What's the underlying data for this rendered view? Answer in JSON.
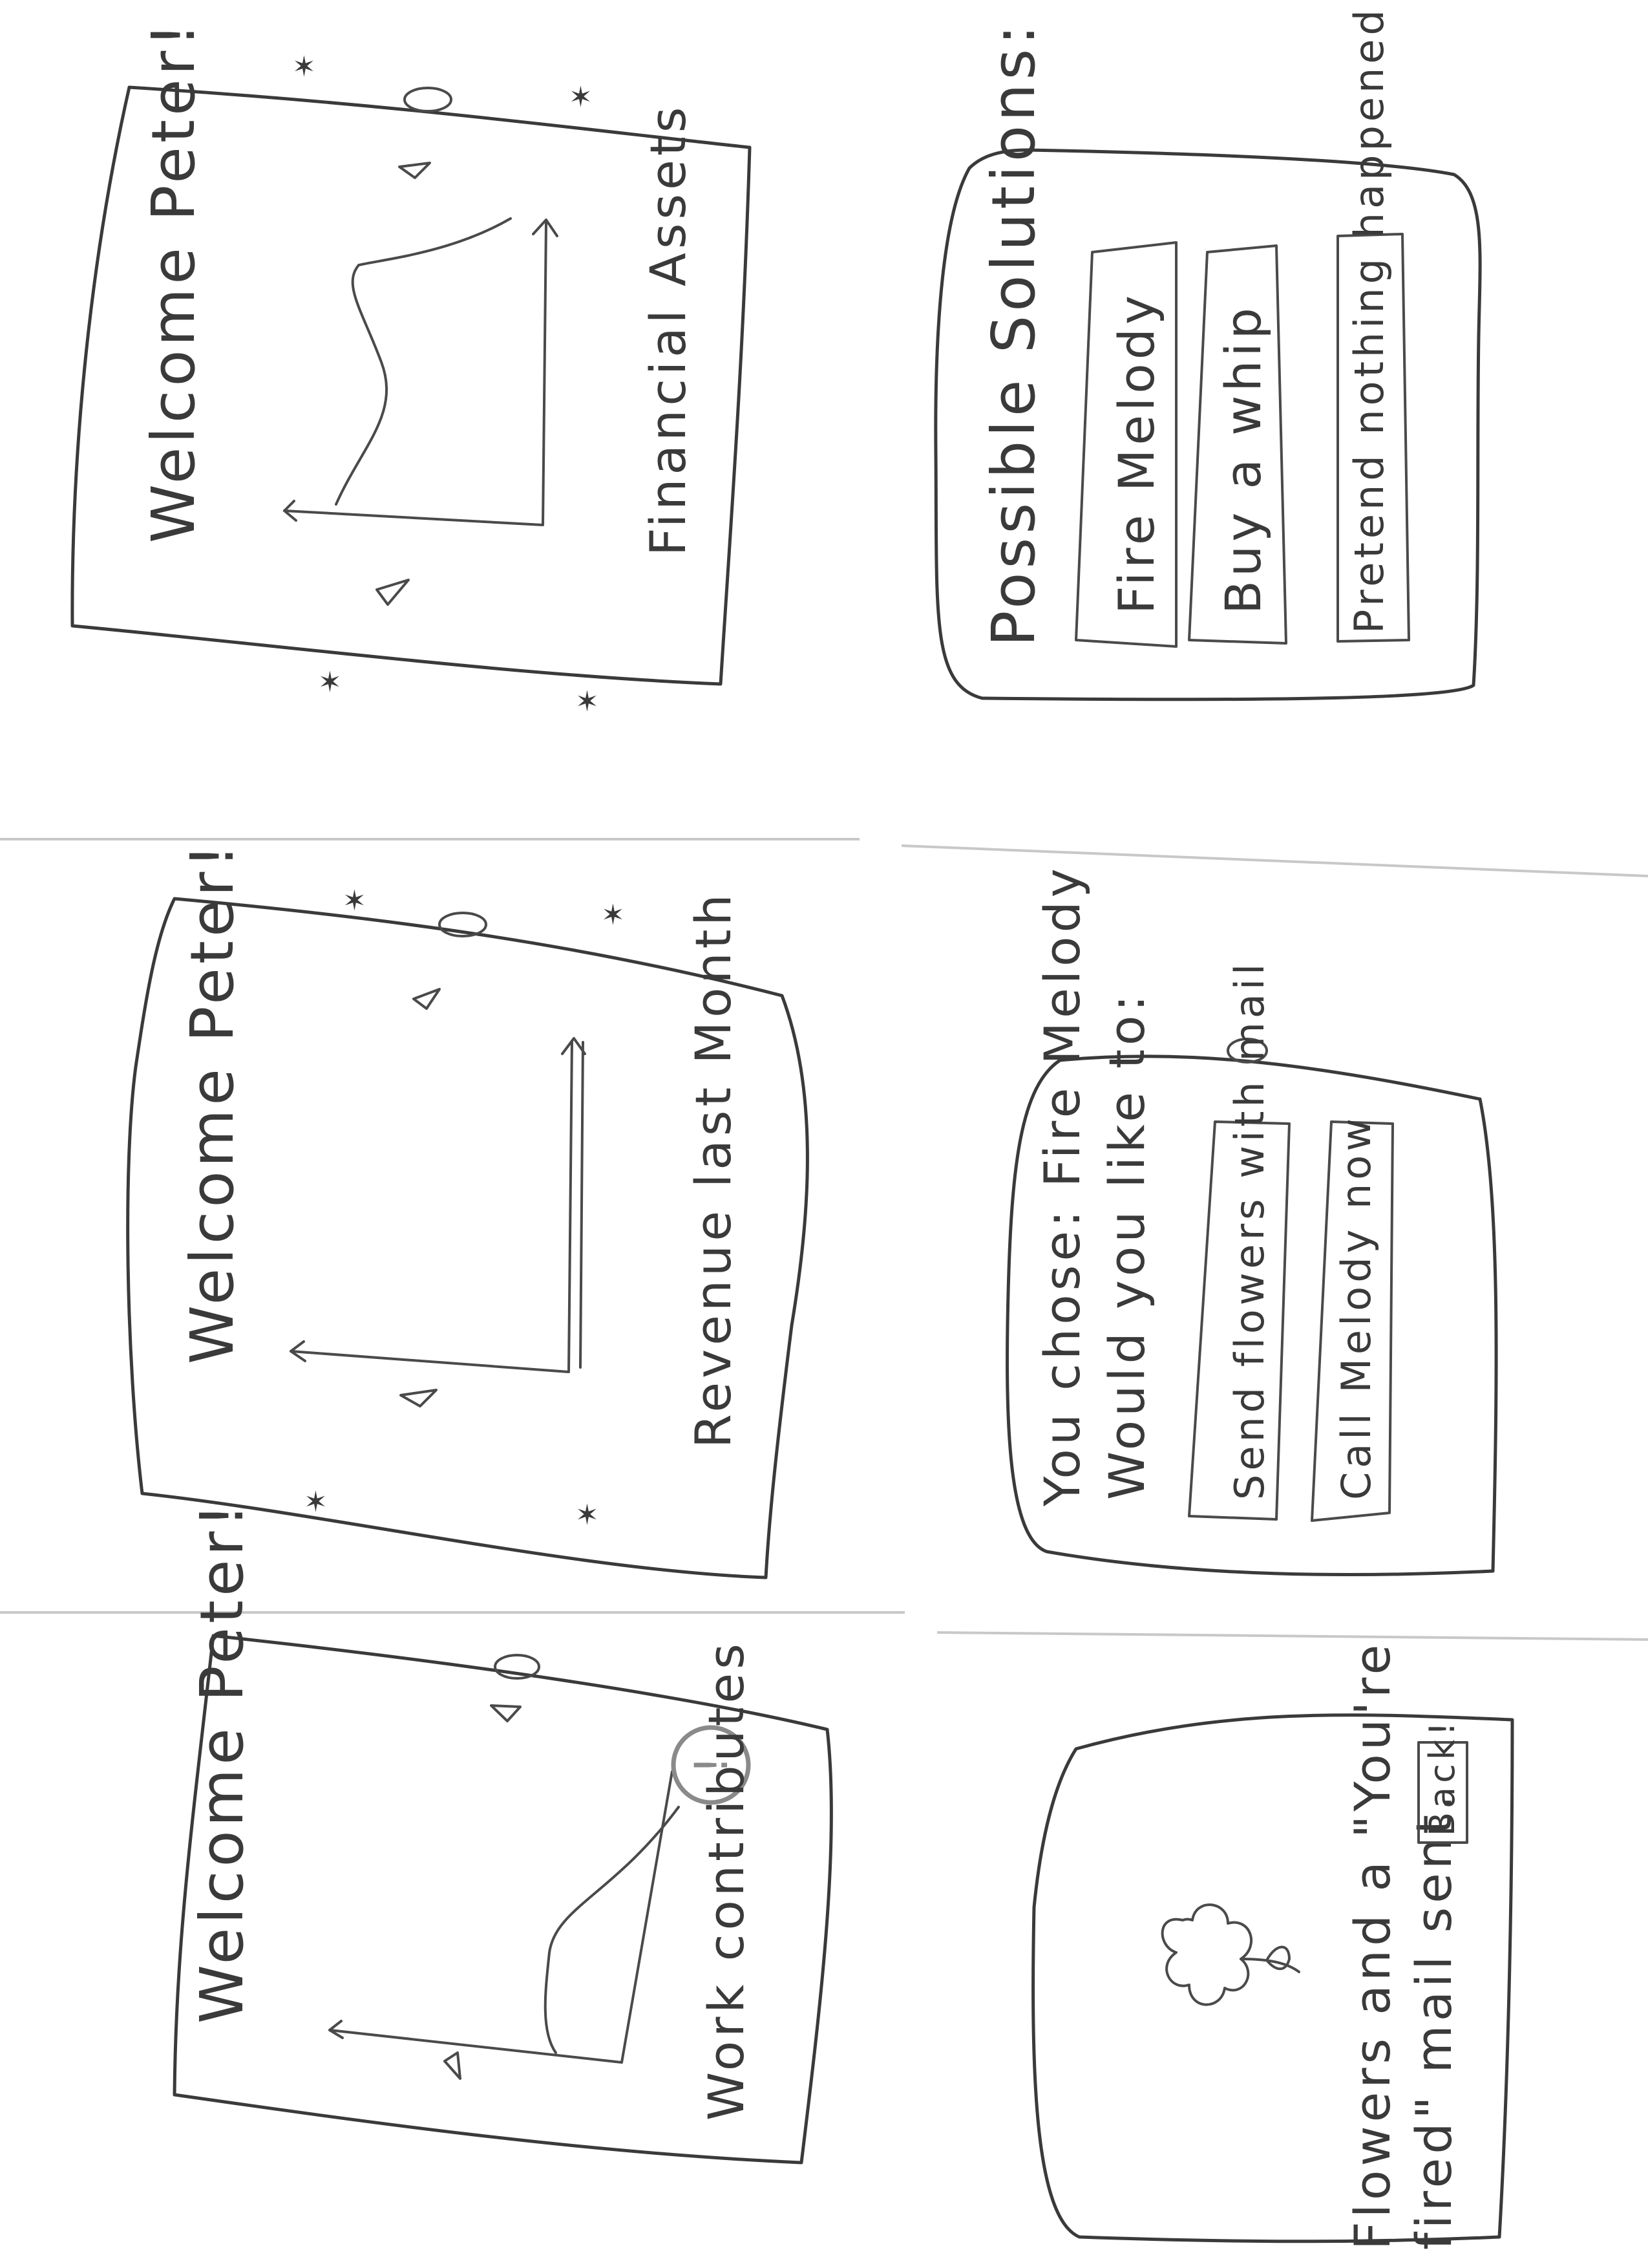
{
  "screens": {
    "financial_assets": {
      "greeting": "Welcome Peter!",
      "chart_caption": "Financial Assets"
    },
    "revenue": {
      "greeting": "Welcome Peter!",
      "chart_caption": "Revenue last Month"
    },
    "work_contributes": {
      "greeting": "Welcome Peter!",
      "chart_caption": "Work contributes",
      "alert_symbol": "!"
    },
    "possible_solutions": {
      "heading": "Possible Solutions:",
      "options": [
        "Fire Melody",
        "Buy a whip",
        "Pretend nothing happened"
      ]
    },
    "follow_up": {
      "prompt_line1": "You chose: Fire Melody",
      "prompt_line2": "Would you like to:",
      "options": [
        "Send flowers with mail",
        "Call Melody now"
      ]
    },
    "confirmation": {
      "message_line1": "Flowers and a \"You're",
      "message_line2": "fired\" mail sent.",
      "back_label": "Back!"
    }
  }
}
